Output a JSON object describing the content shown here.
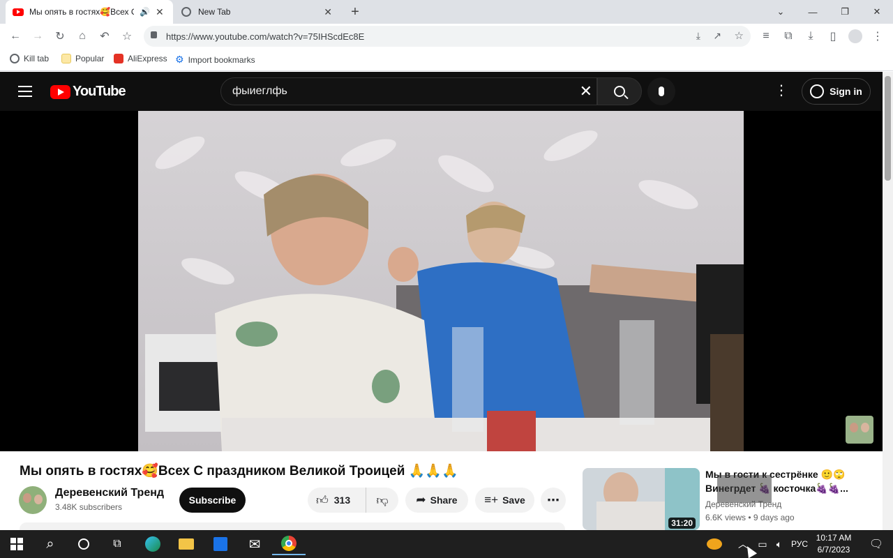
{
  "browser": {
    "tabs": [
      {
        "title": "Мы опять в гостях🥰Всех С",
        "active": true
      },
      {
        "title": "New Tab",
        "active": false
      }
    ],
    "new_tab_icon": "plus-icon",
    "url": "https://www.youtube.com/watch?v=75IHScdEc8E",
    "bookmarks": [
      {
        "label": "Kill tab",
        "icon": "globe-icon"
      },
      {
        "label": "Popular",
        "icon": "folder-icon"
      },
      {
        "label": "AliExpress",
        "icon": "aliexpress-icon"
      },
      {
        "label": "Import bookmarks",
        "icon": "gear-icon"
      }
    ]
  },
  "youtube": {
    "logo_text": "YouTube",
    "search_value": "фыиеглфь",
    "sign_in": "Sign in",
    "video_title": "Мы опять в гостях🥰Всех С праздником Великой Троицей 🙏🙏🙏",
    "channel_name": "Деревенский Тренд",
    "subscribers": "3.48K subscribers",
    "subscribe_label": "Subscribe",
    "likes": "313",
    "share_label": "Share",
    "save_label": "Save",
    "recommended": {
      "title_line1": "Мы в гости к сестрёнке 🙂🙄",
      "title_line2": "Винегрдет 🍇 косточка🍇🍇...",
      "channel": "Деревенский Тренд",
      "meta": "6.6K views • 9 days ago",
      "duration": "31:20"
    }
  },
  "taskbar": {
    "language": "РУС",
    "time": "10:17 AM",
    "date": "6/7/2023"
  },
  "colors": {
    "yt_red": "#ff0000",
    "yt_dark": "#0f0f0f",
    "taskbar": "#1f1f1f"
  }
}
